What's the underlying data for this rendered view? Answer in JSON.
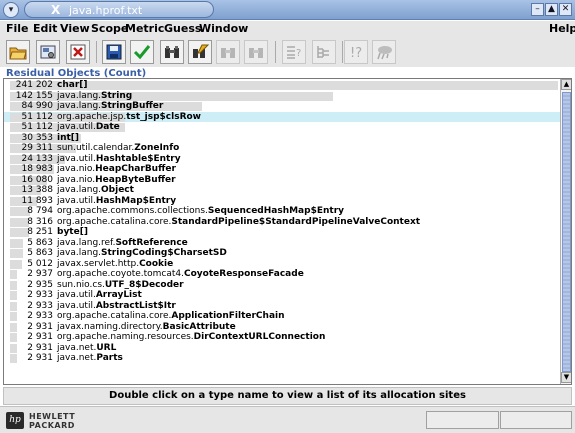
{
  "window": {
    "title": "java.hprof.txt"
  },
  "menubar": {
    "items": [
      "File",
      "Edit",
      "View",
      "Scope",
      "Metric",
      "Guess",
      "Window"
    ],
    "help": "Help"
  },
  "toolbar": {
    "buttons": [
      "open-folder-icon",
      "settings-icon",
      "stop-icon",
      "save-icon",
      "check-icon",
      "binoculars-icon",
      "binoculars-pencil-icon",
      "binoculars-disabled-icon",
      "binoculars-disabled-icon",
      "sort-list-icon",
      "tree-icon",
      "help-icon",
      "gc-icon"
    ]
  },
  "panel": {
    "title": "Residual Objects (Count)"
  },
  "list": {
    "rows": [
      {
        "count": "241 202",
        "pkg": "",
        "cls": "char[]",
        "fill": 1.0
      },
      {
        "count": "142 155",
        "pkg": "java.lang.",
        "cls": "String",
        "fill": 0.59
      },
      {
        "count": "84 990",
        "pkg": "java.lang.",
        "cls": "StringBuffer",
        "fill": 0.35
      },
      {
        "count": "51 112",
        "pkg": "org.apache.jsp.",
        "cls": "tst_jsp$clsRow",
        "fill": 0.21,
        "selected": true
      },
      {
        "count": "51 112",
        "pkg": "java.util.",
        "cls": "Date",
        "fill": 0.21
      },
      {
        "count": "30 353",
        "pkg": "",
        "cls": "int[]",
        "fill": 0.13
      },
      {
        "count": "29 311",
        "pkg": "sun.util.calendar.",
        "cls": "ZoneInfo",
        "fill": 0.12
      },
      {
        "count": "24 133",
        "pkg": "java.util.",
        "cls": "Hashtable$Entry",
        "fill": 0.1
      },
      {
        "count": "18 983",
        "pkg": "java.nio.",
        "cls": "HeapCharBuffer",
        "fill": 0.08
      },
      {
        "count": "16 080",
        "pkg": "java.nio.",
        "cls": "HeapByteBuffer",
        "fill": 0.067
      },
      {
        "count": "13 388",
        "pkg": "java.lang.",
        "cls": "Object",
        "fill": 0.056
      },
      {
        "count": "11 893",
        "pkg": "java.util.",
        "cls": "HashMap$Entry",
        "fill": 0.049
      },
      {
        "count": "8 794",
        "pkg": "org.apache.commons.collections.",
        "cls": "SequencedHashMap$Entry",
        "fill": 0.036
      },
      {
        "count": "8 316",
        "pkg": "org.apache.catalina.core.",
        "cls": "StandardPipeline$StandardPipelineValveContext",
        "fill": 0.034
      },
      {
        "count": "8 251",
        "pkg": "",
        "cls": "byte[]",
        "fill": 0.034
      },
      {
        "count": "5 863",
        "pkg": "java.lang.ref.",
        "cls": "SoftReference",
        "fill": 0.024
      },
      {
        "count": "5 863",
        "pkg": "java.lang.",
        "cls": "StringCoding$CharsetSD",
        "fill": 0.024
      },
      {
        "count": "5 012",
        "pkg": "javax.servlet.http.",
        "cls": "Cookie",
        "fill": 0.021
      },
      {
        "count": "2 937",
        "pkg": "org.apache.coyote.tomcat4.",
        "cls": "CoyoteResponseFacade",
        "fill": 0.012
      },
      {
        "count": "2 935",
        "pkg": "sun.nio.cs.",
        "cls": "UTF_8$Decoder",
        "fill": 0.012
      },
      {
        "count": "2 933",
        "pkg": "java.util.",
        "cls": "ArrayList",
        "fill": 0.012
      },
      {
        "count": "2 933",
        "pkg": "java.util.",
        "cls": "AbstractList$Itr",
        "fill": 0.012
      },
      {
        "count": "2 933",
        "pkg": "org.apache.catalina.core.",
        "cls": "ApplicationFilterChain",
        "fill": 0.012
      },
      {
        "count": "2 931",
        "pkg": "javax.naming.directory.",
        "cls": "BasicAttribute",
        "fill": 0.012
      },
      {
        "count": "2 931",
        "pkg": "org.apache.naming.resources.",
        "cls": "DirContextURLConnection",
        "fill": 0.012
      },
      {
        "count": "2 931",
        "pkg": "java.net.",
        "cls": "URL",
        "fill": 0.012
      },
      {
        "count": "2 931",
        "pkg": "java.net.",
        "cls": "Parts",
        "fill": 0.012
      }
    ]
  },
  "hint": {
    "text": "Double click on a type name to view a list of its allocation sites"
  },
  "footer": {
    "logo_mark": "hp",
    "brand_line1": "HEWLETT",
    "brand_line2": "PACKARD"
  },
  "colors": {
    "selected_row": "#cdeef6",
    "bar": "#dcdcdc",
    "panel_title": "#3a5fa6"
  }
}
